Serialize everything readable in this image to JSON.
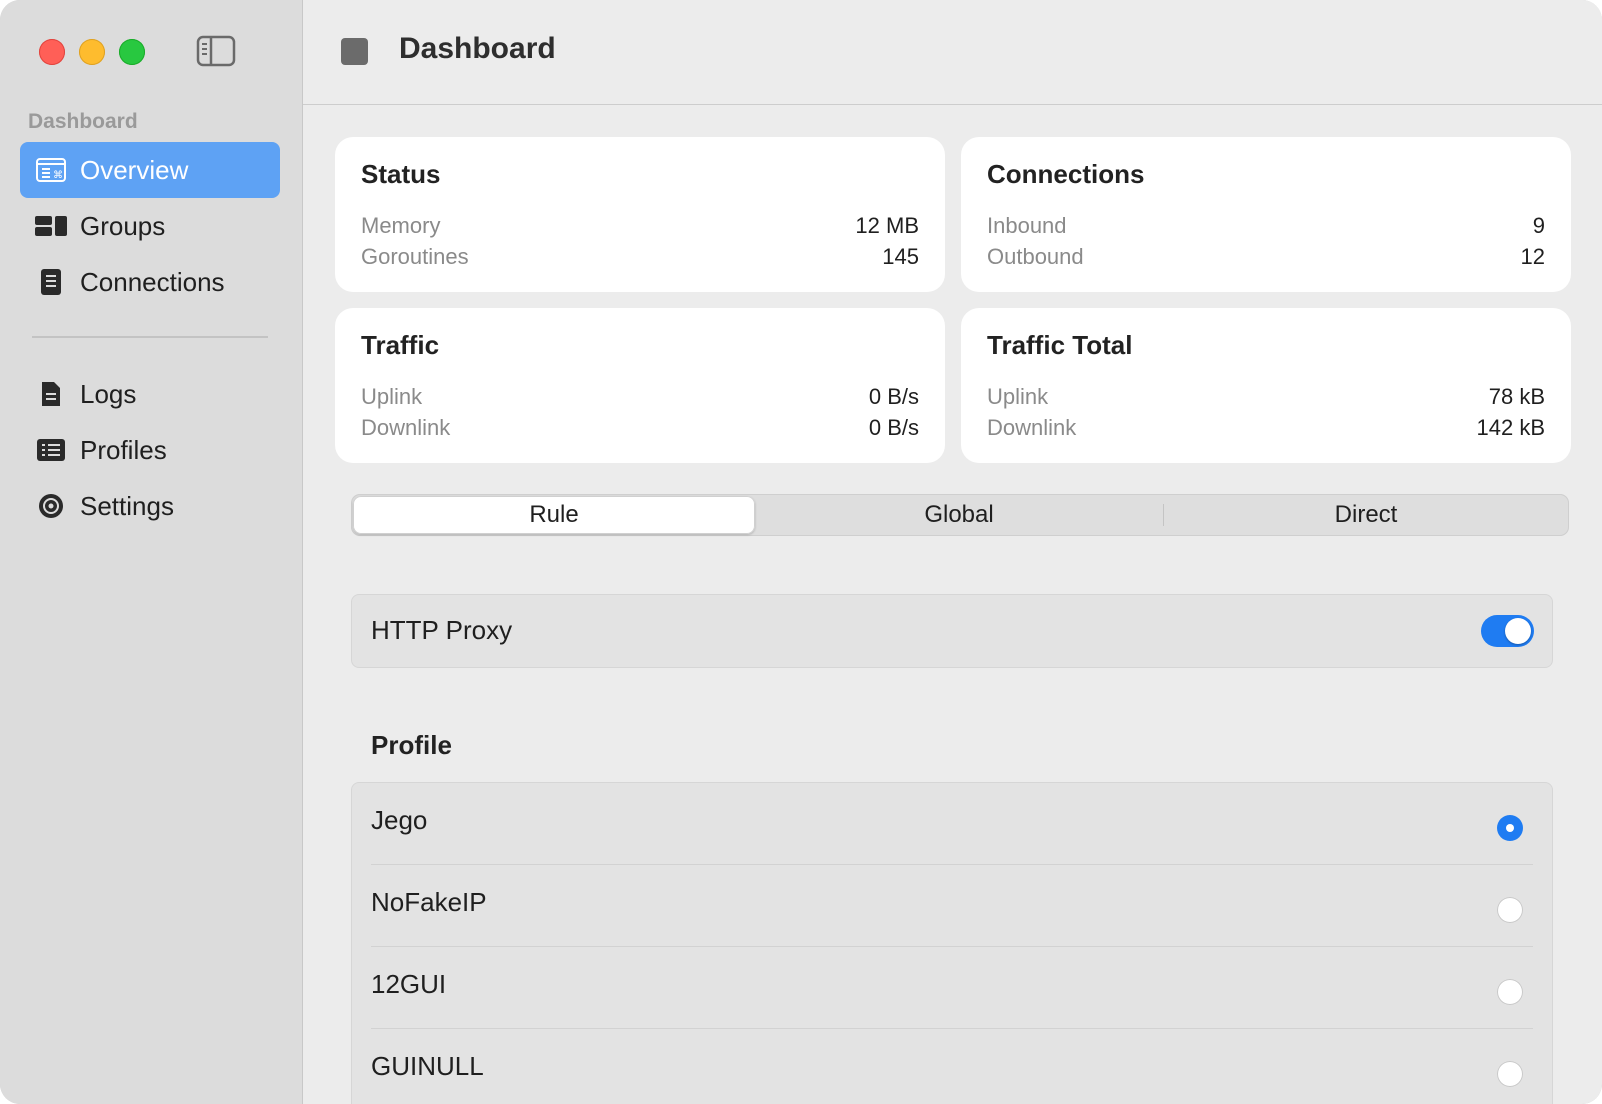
{
  "sidebar": {
    "section_title": "Dashboard",
    "items": [
      {
        "label": "Overview",
        "icon": "overview-icon",
        "active": true
      },
      {
        "label": "Groups",
        "icon": "groups-icon",
        "active": false
      },
      {
        "label": "Connections",
        "icon": "connections-icon",
        "active": false
      },
      {
        "label": "Logs",
        "icon": "logs-icon",
        "active": false
      },
      {
        "label": "Profiles",
        "icon": "profiles-icon",
        "active": false
      },
      {
        "label": "Settings",
        "icon": "settings-icon",
        "active": false
      }
    ]
  },
  "toolbar": {
    "title": "Dashboard"
  },
  "cards": {
    "status": {
      "title": "Status",
      "rows": [
        {
          "k": "Memory",
          "v": "12 MB"
        },
        {
          "k": "Goroutines",
          "v": "145"
        }
      ]
    },
    "connections": {
      "title": "Connections",
      "rows": [
        {
          "k": "Inbound",
          "v": "9"
        },
        {
          "k": "Outbound",
          "v": "12"
        }
      ]
    },
    "traffic": {
      "title": "Traffic",
      "rows": [
        {
          "k": "Uplink",
          "v": "0 B/s"
        },
        {
          "k": "Downlink",
          "v": "0 B/s"
        }
      ]
    },
    "traffic_total": {
      "title": "Traffic Total",
      "rows": [
        {
          "k": "Uplink",
          "v": "78 kB"
        },
        {
          "k": "Downlink",
          "v": "142 kB"
        }
      ]
    }
  },
  "mode": {
    "options": [
      "Rule",
      "Global",
      "Direct"
    ],
    "selected": "Rule"
  },
  "http_proxy": {
    "label": "HTTP Proxy",
    "enabled": true
  },
  "profile": {
    "heading": "Profile",
    "items": [
      "Jego",
      "NoFakeIP",
      "12GUI",
      "GUINULL"
    ],
    "selected": "Jego"
  },
  "colors": {
    "accent": "#1f7cf2",
    "sidebar_active": "#5ea2f4"
  }
}
